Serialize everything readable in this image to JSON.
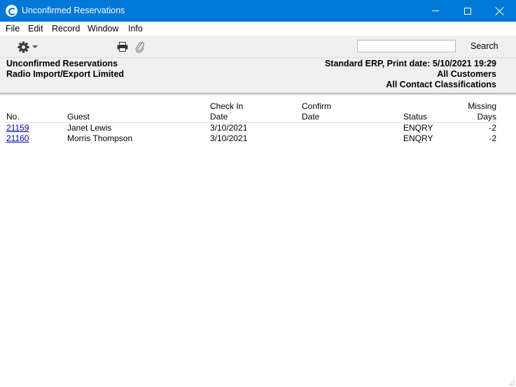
{
  "window": {
    "title": "Unconfirmed Reservations"
  },
  "menu": [
    "File",
    "Edit",
    "Record",
    "Window",
    "Info"
  ],
  "toolbar": {
    "search_value": "",
    "search_label": "Search"
  },
  "report_header": {
    "left": [
      "Unconfirmed Reservations",
      "Radio Import/Export Limited"
    ],
    "right": [
      "Standard ERP, Print date: 5/10/2021 19:29",
      "All Customers",
      "All Contact Classifications"
    ]
  },
  "table": {
    "headers": {
      "no": [
        "",
        "No."
      ],
      "guest": [
        "",
        "Guest"
      ],
      "checkin": [
        "Check In",
        "Date"
      ],
      "confirm": [
        "Confirm",
        "Date"
      ],
      "status": [
        "",
        "Status"
      ],
      "missing": [
        "Missing",
        "Days"
      ]
    },
    "rows": [
      {
        "no": "21159",
        "guest": "Janet Lewis",
        "checkin": "3/10/2021",
        "confirm": "",
        "status": "ENQRY",
        "missing": "-2"
      },
      {
        "no": "21160",
        "guest": "Morris Thompson",
        "checkin": "3/10/2021",
        "confirm": "",
        "status": "ENQRY",
        "missing": "-2"
      }
    ]
  },
  "colors": {
    "titlebar": "#0078d7",
    "link": "#0000aa",
    "toolbar_bg": "#f0f0f0"
  }
}
